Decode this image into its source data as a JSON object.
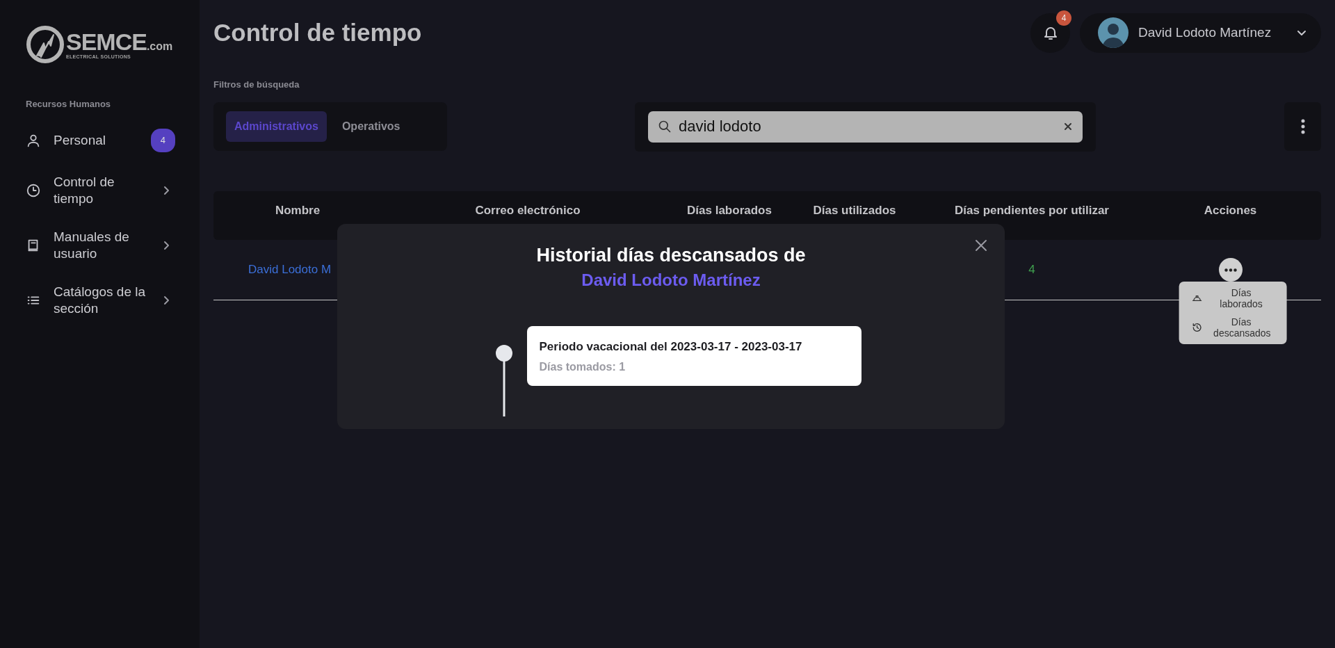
{
  "sidebar": {
    "logo": {
      "name": "SEMCE",
      "suffix": ".com",
      "tagline": "ELECTRICAL SOLUTIONS"
    },
    "section": "Recursos Humanos",
    "items": [
      {
        "kind": "person",
        "label": "Personal",
        "badge": "4",
        "expandable": false
      },
      {
        "kind": "clock",
        "label": "Control de tiempo",
        "expandable": true
      },
      {
        "kind": "book",
        "label": "Manuales de usuario",
        "expandable": true
      },
      {
        "kind": "list",
        "label": "Catálogos de la sección",
        "expandable": true
      }
    ]
  },
  "header": {
    "title": "Control de tiempo",
    "notifications": "4",
    "user": {
      "name": "David Lodoto Martínez"
    }
  },
  "filters": {
    "label": "Filtros de búsqueda",
    "tabs": [
      {
        "label": "Administrativos",
        "selected": true
      },
      {
        "label": "Operativos",
        "selected": false
      }
    ],
    "search": {
      "value": "david lodoto"
    }
  },
  "table": {
    "columns": [
      "Nombre",
      "Correo electrónico",
      "Días laborados",
      "Días utilizados",
      "Días pendientes por utilizar",
      "Acciones"
    ],
    "rows": [
      {
        "name": "David Lodoto M",
        "pending": "4"
      }
    ]
  },
  "actions_menu": {
    "items": [
      {
        "kind": "hardhat",
        "label": "Días laborados"
      },
      {
        "kind": "history",
        "label": "Días descansados"
      }
    ]
  },
  "modal": {
    "title": "Historial días descansados de",
    "subject": "David Lodoto Martínez",
    "entries": [
      {
        "title": "Periodo vacacional del 2023-03-17 - 2023-03-17",
        "detail": "Días tomados: 1"
      }
    ]
  }
}
